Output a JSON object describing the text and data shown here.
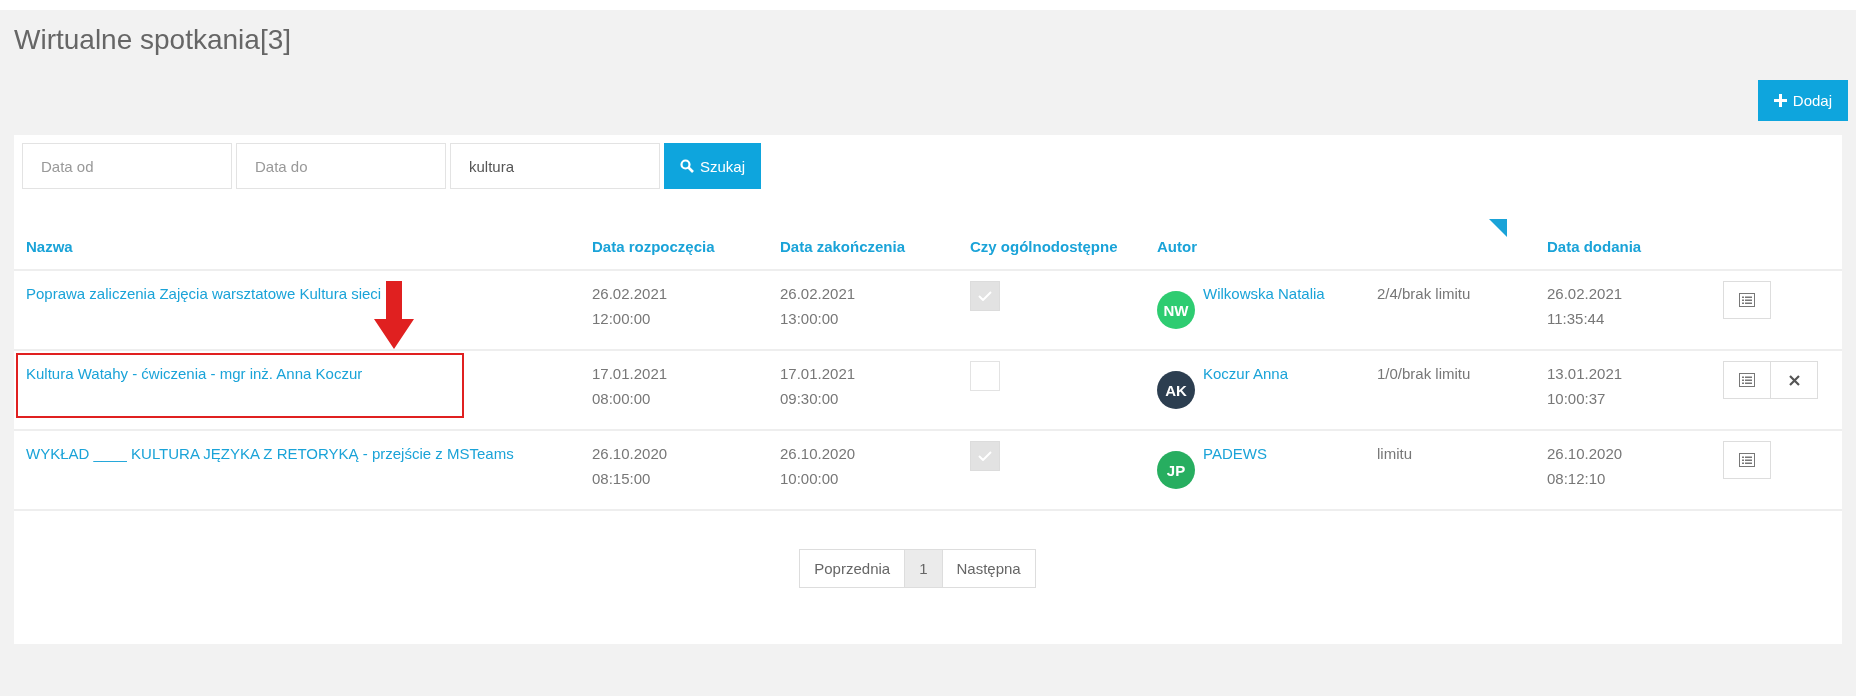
{
  "page": {
    "title": "Wirtualne spotkania[3]"
  },
  "add_button": {
    "label": "Dodaj"
  },
  "filters": {
    "date_from": {
      "placeholder": "Data od"
    },
    "date_to": {
      "placeholder": "Data do"
    },
    "query": {
      "value": "kultura"
    },
    "search_button": {
      "label": "Szukaj"
    }
  },
  "table": {
    "columns": [
      "Nazwa",
      "Data rozpoczęcia",
      "Data zakończenia",
      "Czy ogólnodostępne",
      "Autor",
      "",
      "Data dodania"
    ],
    "rows": [
      {
        "name": "Poprawa zaliczenia Zajęcia warsztatowe Kultura sieci",
        "start": [
          "26.02.2021",
          "12:00:00"
        ],
        "end": [
          "26.02.2021",
          "13:00:00"
        ],
        "public": true,
        "author": {
          "initials": "NW",
          "name": "Wilkowska Natalia",
          "color": "#2ecc71"
        },
        "limit": "2/4/brak limitu",
        "added": [
          "26.02.2021",
          "11:35:44"
        ],
        "deletable": false,
        "highlighted": false
      },
      {
        "name": "Kultura Watahy - ćwiczenia - mgr inż. Anna Koczur",
        "start": [
          "17.01.2021",
          "08:00:00"
        ],
        "end": [
          "17.01.2021",
          "09:30:00"
        ],
        "public": false,
        "author": {
          "initials": "AK",
          "name": "Koczur Anna",
          "color": "#2c3e50"
        },
        "limit": "1/0/brak limitu",
        "added": [
          "13.01.2021",
          "10:00:37"
        ],
        "deletable": true,
        "highlighted": true
      },
      {
        "name": "WYKŁAD ____ KULTURA JĘZYKA Z RETORYKĄ - przejście z MSTeams",
        "start": [
          "26.10.2020",
          "08:15:00"
        ],
        "end": [
          "26.10.2020",
          "10:00:00"
        ],
        "public": true,
        "author": {
          "initials": "JP",
          "name": "PADEWS",
          "color": "#27ae60"
        },
        "limit": "limitu",
        "added": [
          "26.10.2020",
          "08:12:10"
        ],
        "deletable": false,
        "highlighted": false
      }
    ]
  },
  "pagination": {
    "previous": "Poprzednia",
    "pages": [
      {
        "label": "1",
        "selected": true
      }
    ],
    "next": "Następna"
  }
}
